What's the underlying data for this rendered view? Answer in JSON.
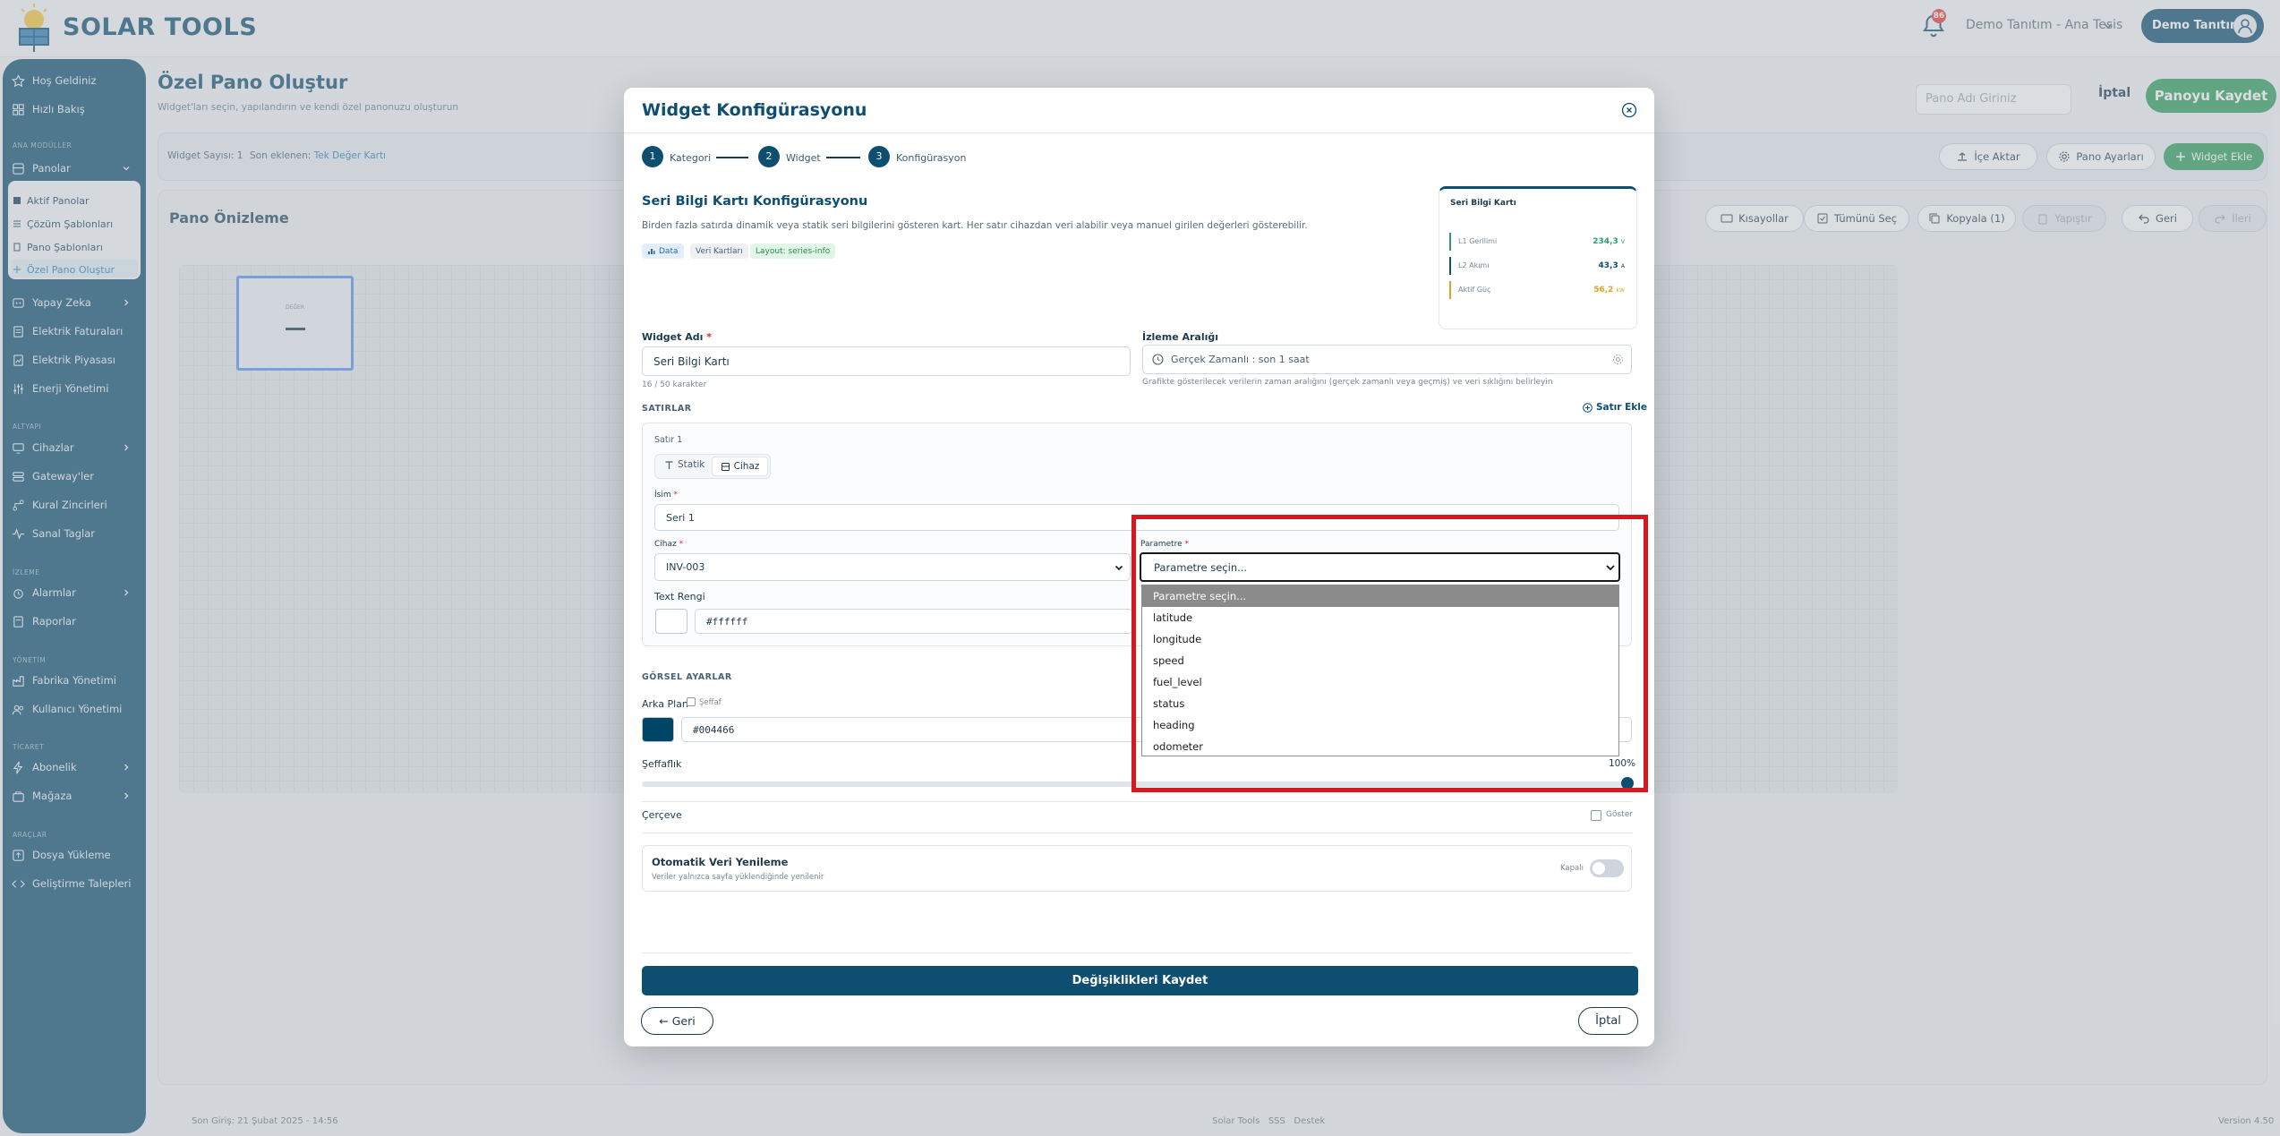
{
  "app": {
    "brand": "SOLAR TOOLS",
    "notifications": "86",
    "tenant": "Demo Tanıtım - Ana Tesis",
    "user": "Demo Tanıtım"
  },
  "sidebar": {
    "top": [
      {
        "label": "Hoş Geldiniz"
      },
      {
        "label": "Hızlı Bakış"
      }
    ],
    "section_analysis": "ANA MODÜLLER",
    "panolar": "Panolar",
    "sub": [
      {
        "label": "Aktif Panolar"
      },
      {
        "label": "Çözüm Şablonları"
      },
      {
        "label": "Pano Şablonları"
      },
      {
        "label": "Özel Pano Oluştur"
      }
    ],
    "mid": [
      {
        "label": "Yapay Zeka"
      },
      {
        "label": "Elektrik Faturaları"
      },
      {
        "label": "Elektrik Piyasası"
      },
      {
        "label": "Enerji Yönetimi"
      }
    ],
    "section_infra": "ALTYAPI",
    "infra": [
      {
        "label": "Cihazlar"
      },
      {
        "label": "Gateway'ler"
      },
      {
        "label": "Kural Zincirleri"
      },
      {
        "label": "Sanal Taglar"
      }
    ],
    "section_monitor": "İZLEME",
    "monitor": [
      {
        "label": "Alarmlar"
      },
      {
        "label": "Raporlar"
      }
    ],
    "section_manage": "YÖNETİM",
    "manage": [
      {
        "label": "Fabrika Yönetimi"
      },
      {
        "label": "Kullanıcı Yönetimi"
      }
    ],
    "section_trade": "TİCARET",
    "trade": [
      {
        "label": "Abonelik"
      },
      {
        "label": "Mağaza"
      }
    ],
    "section_tools": "ARAÇLAR",
    "tools": [
      {
        "label": "Dosya Yükleme"
      },
      {
        "label": "Geliştirme Talepleri"
      }
    ]
  },
  "page": {
    "title": "Özel Pano Oluştur",
    "subtitle": "Widget'ları seçin, yapılandırın ve kendi özel panonuzu oluşturun",
    "name_placeholder": "Pano Adı Giriniz",
    "cancel": "İptal",
    "save": "Panoyu Kaydet",
    "widget_count": "Widget Sayısı: 1",
    "last_added_label": "Son eklenen:",
    "last_added_value": "Tek Değer Kartı",
    "import": "İçe Aktar",
    "settings": "Pano Ayarları",
    "add_widget": "Widget Ekle",
    "preview_title": "Pano Önizleme",
    "toolbar": [
      "Kısayollar",
      "Tümünü Seç",
      "Kopyala (1)",
      "Yapıştır",
      "Geri",
      "İleri"
    ],
    "grid_widget_label": "DEĞER",
    "grid_widget_value": "—"
  },
  "footer": {
    "last_login": "Son Giriş: 21 Şubat 2025 - 14:56",
    "links": "Solar Tools   SSS   Destek",
    "version": "Version 4.50"
  },
  "modal": {
    "title": "Widget Konfigürasyonu",
    "steps": [
      {
        "num": "1",
        "label": "Kategori"
      },
      {
        "num": "2",
        "label": "Widget"
      },
      {
        "num": "3",
        "label": "Konfigürasyon"
      }
    ],
    "section_title": "Seri Bilgi Kartı Konfigürasyonu",
    "section_desc": "Birden fazla satırda dinamik veya statik seri bilgilerini gösteren kart. Her satır cihazdan veri alabilir veya manuel girilen değerleri gösterebilir.",
    "tags": [
      "Data",
      "Veri Kartları",
      "Layout: series-info"
    ],
    "preview": {
      "title": "Seri Bilgi Kartı",
      "rows": [
        {
          "label": "L1 Gerilimi",
          "value": "234,3",
          "unit": "V",
          "color": "#2a9e6e"
        },
        {
          "label": "L2 Akımı",
          "value": "43,3",
          "unit": "A",
          "color": "#0e4e70"
        },
        {
          "label": "Aktif Güç",
          "value": "56,2",
          "unit": "kW",
          "color": "#e0a020"
        }
      ]
    },
    "widget_name_label": "Widget Adı",
    "widget_name_value": "Seri Bilgi Kartı",
    "widget_name_count": "16 / 50 karakter",
    "interval_label": "İzleme Aralığı",
    "interval_value": "Gerçek Zamanlı : son 1 saat",
    "interval_hint": "Grafikte gösterilecek verilerin zaman aralığını (gerçek zamanlı veya geçmiş) ve veri sıklığını belirleyin",
    "rows_label": "SATIRLAR",
    "add_row": "Satır Ekle",
    "row_title": "Satır 1",
    "mode_static": "Statik",
    "mode_device": "Cihaz",
    "name_label": "İsim",
    "name_value": "Seri 1",
    "device_label": "Cihaz",
    "device_value": "INV-003",
    "param_label": "Parametre",
    "param_value": "Parametre seçin...",
    "text_color_label": "Text Rengi",
    "text_color_value": "#ffffff",
    "options": [
      "Parametre seçin...",
      "latitude",
      "longitude",
      "speed",
      "fuel_level",
      "status",
      "heading",
      "odometer"
    ],
    "visual_label": "GÖRSEL AYARLAR",
    "bg_label": "Arka Plan",
    "transparent": "Şeffaf",
    "bg_value": "#004466",
    "opacity_label": "Şeffaflık",
    "opacity_value": "100%",
    "frame_label": "Çerçeve",
    "show": "Göster",
    "refresh_title": "Otomatik Veri Yenileme",
    "refresh_desc": "Veriler yalnızca sayfa yüklendiğinde yenilenir",
    "refresh_state": "Kapalı",
    "save": "Değişiklikleri Kaydet",
    "back": "← Geri",
    "cancel": "İptal"
  }
}
